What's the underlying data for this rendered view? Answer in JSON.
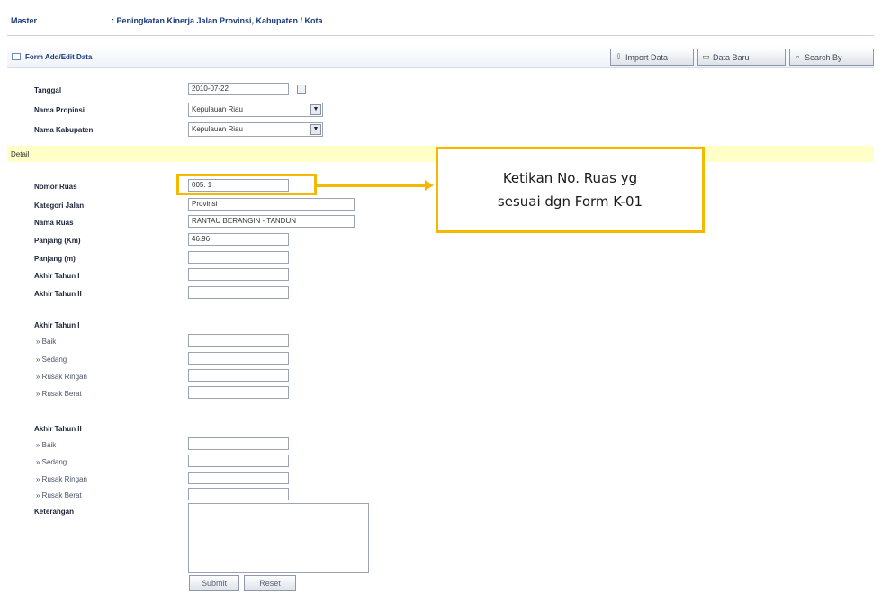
{
  "header": {
    "module": "Master",
    "title": ": Peningkatan Kinerja Jalan Provinsi, Kabupaten / Kota"
  },
  "form_bar": {
    "title": "Form Add/Edit Data",
    "buttons": {
      "import": "Import Data",
      "new": "Data Baru",
      "search": "Search By"
    }
  },
  "main_form": {
    "tanggal": {
      "label": "Tanggal",
      "value": "2010-07-22"
    },
    "propinsi": {
      "label": "Nama Propinsi",
      "value": "Kepulauan Riau"
    },
    "kabupaten": {
      "label": "Nama Kabupaten",
      "value": "Kepulauan Riau"
    }
  },
  "detail": {
    "section_label": "Detail",
    "fields": {
      "nomor_ruas": {
        "label": "Nomor Ruas",
        "value": "005. 1"
      },
      "kategori_jalan": {
        "label": "Kategori Jalan",
        "value": "Provinsi"
      },
      "nama_ruas": {
        "label": "Nama Ruas",
        "value": "RANTAU  BERANGIN - TANDUN"
      },
      "panjang_km": {
        "label": "Panjang (Km)",
        "value": "46.96"
      },
      "panjang_m": {
        "label": "Panjang (m)",
        "value": ""
      },
      "akhir_tahun_1": {
        "label": "Akhir Tahun I",
        "value": ""
      },
      "akhir_tahun_2": {
        "label": "Akhir Tahun II",
        "value": ""
      }
    },
    "group1": {
      "title": "Akhir Tahun I",
      "baik": "» Baik",
      "sedang": "» Sedang",
      "rusak_ringan": "» Rusak Ringan",
      "rusak_berat": "» Rusak Berat"
    },
    "group2": {
      "title": "Akhir Tahun II",
      "baik": "» Baik",
      "sedang": "» Sedang",
      "rusak_ringan": "» Rusak Ringan",
      "rusak_berat": "» Rusak Berat"
    },
    "keterangan": "Keterangan",
    "submit": "Submit",
    "reset": "Reset"
  },
  "annotation": {
    "line1": "Ketikan No. Ruas yg",
    "line2": "sesuai dgn Form K-01"
  },
  "colors": {
    "accent_highlight": "#f5b800",
    "detail_band": "#ffffc8",
    "header_text": "#1a3a7c"
  },
  "icons": {
    "calendar": "calendar-icon",
    "dropdown": "chevron-down-icon",
    "import": "import-icon",
    "new": "new-document-icon",
    "search": "search-icon",
    "form": "form-icon"
  }
}
